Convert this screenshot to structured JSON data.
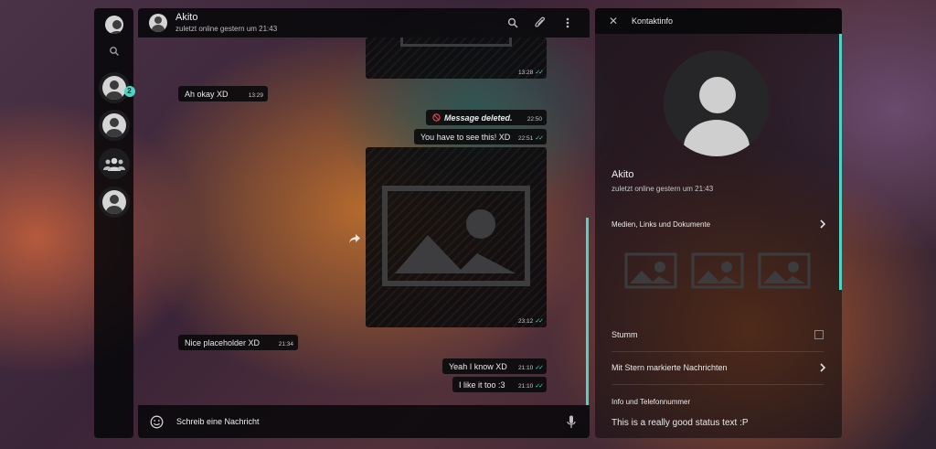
{
  "sidebar": {
    "items": [
      {
        "icon": "person-icon"
      },
      {
        "icon": "search-icon"
      },
      {
        "icon": "person-icon",
        "badge": "2"
      },
      {
        "icon": "person-icon"
      },
      {
        "icon": "group-icon"
      },
      {
        "icon": "person-icon"
      }
    ]
  },
  "chat": {
    "name": "Akito",
    "status": "zuletzt online gestern um 21:43",
    "messages": [
      {
        "text": "",
        "time": "13:28",
        "direction": "out",
        "type": "image"
      },
      {
        "text": "Ah okay XD",
        "time": "13:29",
        "direction": "in"
      },
      {
        "text": "Message deleted.",
        "time": "22:50",
        "direction": "out",
        "deleted": true
      },
      {
        "text": "You have to see this! XD",
        "time": "22:51",
        "direction": "out"
      },
      {
        "text": "",
        "time": "23:12",
        "direction": "out",
        "type": "image"
      },
      {
        "text": "Nice placeholder XD",
        "time": "21:34",
        "direction": "in"
      },
      {
        "text": "Yeah I know XD",
        "time": "21:10",
        "direction": "out"
      },
      {
        "text": "I like it too :3",
        "time": "21:10",
        "direction": "out"
      }
    ],
    "composer_placeholder": "Schreib eine Nachricht"
  },
  "contact": {
    "title": "Kontaktinfo",
    "name": "Akito",
    "status": "zuletzt online gestern um 21:43",
    "media_label": "Medien, Links und Dokumente",
    "mute_label": "Stumm",
    "starred_label": "Mit Stern markierte Nachrichten",
    "info_heading": "Info und Telefonnummer",
    "about": "This is a really good status text :P"
  },
  "colors": {
    "accent": "#4fd3c4",
    "panel": "#08080a"
  }
}
